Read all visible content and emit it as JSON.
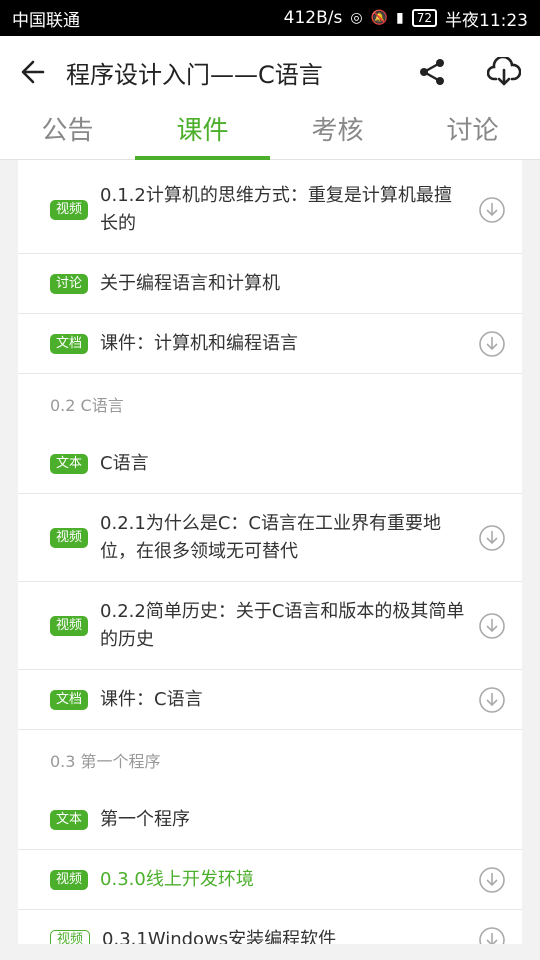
{
  "statusbar": {
    "carrier": "中国联通",
    "speed": "412B/s",
    "battery": "72",
    "time": "半夜11:23"
  },
  "toolbar": {
    "title": "程序设计入门——C语言"
  },
  "tabs": [
    {
      "label": "公告"
    },
    {
      "label": "课件"
    },
    {
      "label": "考核"
    },
    {
      "label": "讨论"
    }
  ],
  "items": [
    {
      "badge": "视频",
      "text": "0.1.2计算机的思维方式：重复是计算机最擅长的",
      "download": true
    },
    {
      "badge": "讨论",
      "text": "关于编程语言和计算机",
      "download": false
    },
    {
      "badge": "文档",
      "text": "课件：计算机和编程语言",
      "download": true
    },
    {
      "section": "0.2 C语言"
    },
    {
      "badge": "文本",
      "text": "C语言",
      "download": false
    },
    {
      "badge": "视频",
      "text": "0.2.1为什么是C：C语言在工业界有重要地位，在很多领域无可替代",
      "download": true
    },
    {
      "badge": "视频",
      "text": "0.2.2简单历史：关于C语言和版本的极其简单的历史",
      "download": true
    },
    {
      "badge": "文档",
      "text": "课件：C语言",
      "download": true
    },
    {
      "section": "0.3 第一个程序"
    },
    {
      "badge": "文本",
      "text": "第一个程序",
      "download": false
    },
    {
      "badge": "视频",
      "text": "0.3.0线上开发环境",
      "download": true
    },
    {
      "badge": "视频",
      "text": "0.3.1Windows安装编程软件",
      "download": true
    }
  ],
  "colors": {
    "accent": "#4caf2c",
    "statusbar": "#000000"
  }
}
